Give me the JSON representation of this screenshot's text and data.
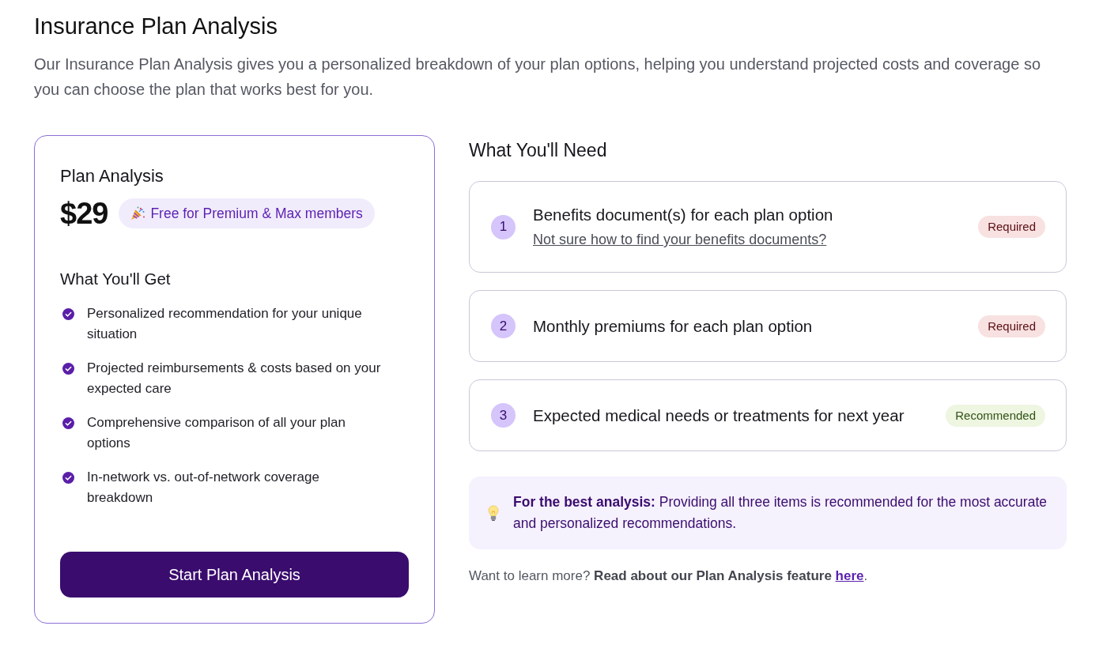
{
  "page": {
    "title": "Insurance Plan Analysis",
    "description": "Our Insurance Plan Analysis gives you a personalized breakdown of your plan options, helping you understand projected costs and coverage so you can choose the plan that works best for you."
  },
  "plan_card": {
    "title": "Plan Analysis",
    "price": "$29",
    "badge": "Free for Premium & Max members",
    "benefits_heading": "What You'll Get",
    "benefits": [
      "Personalized recommendation for your unique situation",
      "Projected reimbursements & costs based on your expected care",
      "Comprehensive comparison of all your plan options",
      "In-network vs. out-of-network coverage breakdown"
    ],
    "button": "Start Plan Analysis"
  },
  "requirements": {
    "heading": "What You'll Need",
    "items": [
      {
        "number": "1",
        "title": "Benefits document(s) for each plan option",
        "link": "Not sure how to find your benefits documents?",
        "tag": {
          "label": "Required",
          "kind": "required"
        }
      },
      {
        "number": "2",
        "title": "Monthly premiums for each plan option",
        "tag": {
          "label": "Required",
          "kind": "required"
        }
      },
      {
        "number": "3",
        "title": "Expected medical needs or treatments for next year",
        "tag": {
          "label": "Recommended",
          "kind": "recommended"
        }
      }
    ],
    "tip": "**For the best analysis:** Providing all three items is recommended for the most accurate and personalized recommendations.",
    "learn_more": {
      "text": "Want to learn more? **Read about our Plan Analysis feature** ",
      "link": "here",
      "after": "."
    }
  }
}
